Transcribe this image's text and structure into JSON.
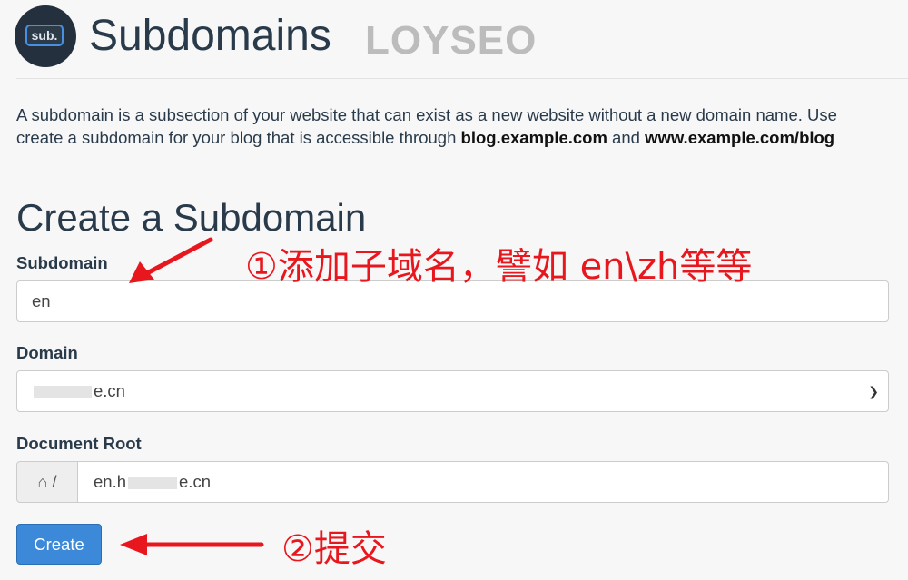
{
  "header": {
    "logo_text": "sub.",
    "title": "Subdomains",
    "watermark": "LOYSEO"
  },
  "description": {
    "line1": "A subdomain is a subsection of your website that can exist as a new website without a new domain name. Use",
    "line2_prefix": "create a subdomain for your blog that is accessible through ",
    "line2_bold1": "blog.example.com",
    "line2_mid": " and ",
    "line2_bold2": "www.example.com/blog"
  },
  "form": {
    "section_title": "Create a Subdomain",
    "subdomain_label": "Subdomain",
    "subdomain_value": "en",
    "domain_label": "Domain",
    "domain_value_visible": "e.cn",
    "docroot_label": "Document Root",
    "docroot_prefix": "/",
    "docroot_value_start": "en.h",
    "docroot_value_end": "e.cn",
    "create_label": "Create"
  },
  "annotations": {
    "step1": "①添加子域名，譬如 en\\zh等等",
    "step2": "②提交",
    "color": "#e8161d"
  },
  "icons": {
    "home": "home-icon",
    "chevron": "chevron-down-icon"
  }
}
